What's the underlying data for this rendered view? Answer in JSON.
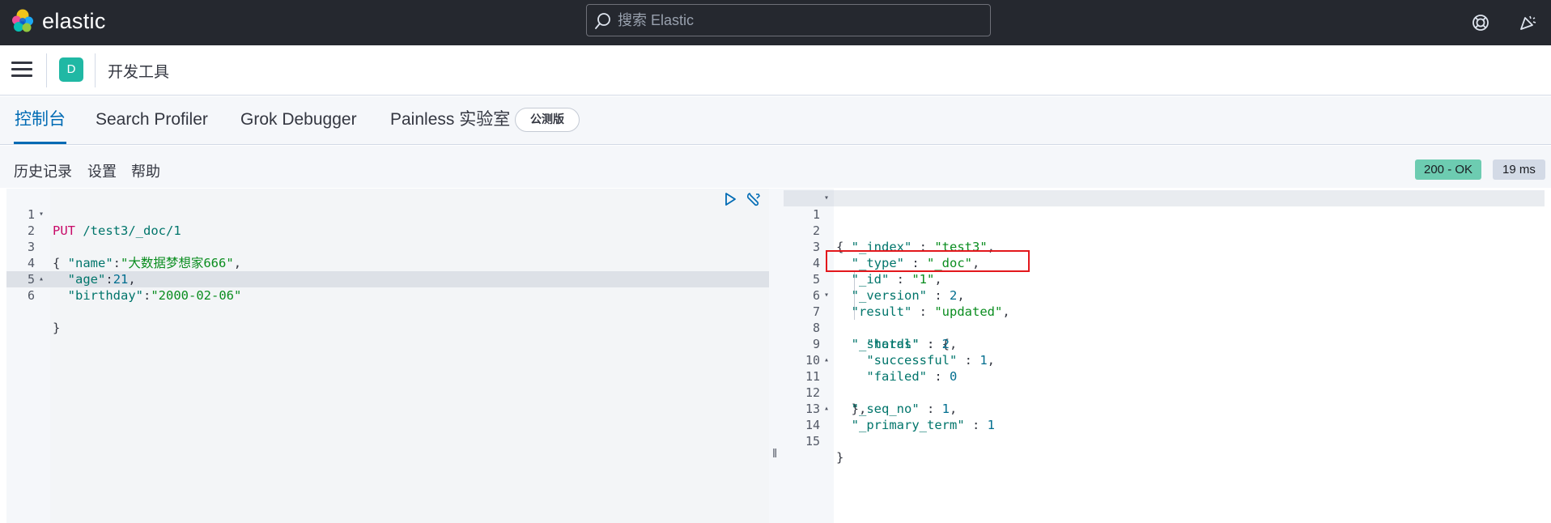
{
  "header": {
    "brand": "elastic",
    "search_placeholder": "搜索 Elastic",
    "help_icon": "lifebuoy-icon",
    "news_icon": "newsfeed-icon"
  },
  "subbar": {
    "space_initial": "D",
    "breadcrumb": "开发工具"
  },
  "tabs": [
    {
      "label": "控制台",
      "active": true
    },
    {
      "label": "Search Profiler",
      "active": false
    },
    {
      "label": "Grok Debugger",
      "active": false
    },
    {
      "label": "Painless 实验室",
      "active": false
    }
  ],
  "beta_badge": "公测版",
  "toolbar": {
    "history": "历史记录",
    "settings": "设置",
    "help": "帮助",
    "status": "200 - OK",
    "time": "19 ms"
  },
  "request": {
    "line_numbers": [
      "1",
      "2",
      "3",
      "4",
      "5",
      "6"
    ],
    "method": "PUT",
    "url": " /test3/_doc/1",
    "open_brace": "{",
    "name_key": "\"name\"",
    "name_val": "\"大数据梦想家666\"",
    "age_key": "\"age\"",
    "age_val": "21",
    "birthday_key": "\"birthday\"",
    "birthday_val": "\"2000-02-06\"",
    "close_brace": "}"
  },
  "response": {
    "line_numbers": [
      "1",
      "2",
      "3",
      "4",
      "5",
      "6",
      "7",
      "8",
      "9",
      "10",
      "11",
      "12",
      "13",
      "14",
      "15"
    ],
    "open_brace": "{",
    "index_key": "\"_index\"",
    "index_val": "\"test3\"",
    "type_key": "\"_type\"",
    "type_val": "\"_doc\"",
    "id_key": "\"_id\"",
    "id_val": "\"1\"",
    "version_key": "\"_version\"",
    "version_val": "2",
    "result_key": "\"result\"",
    "result_val": "\"updated\"",
    "shards_key": "\"_shards\"",
    "total_key": "\"total\"",
    "total_val": "2",
    "successful_key": "\"successful\"",
    "successful_val": "1",
    "failed_key": "\"failed\"",
    "failed_val": "0",
    "shards_close": "},",
    "seq_key": "\"_seq_no\"",
    "seq_val": "1",
    "term_key": "\"_primary_term\"",
    "term_val": "1",
    "close_brace": "}"
  },
  "colors": {
    "header_bg": "#25282f",
    "accent": "#006bb4",
    "status_ok": "#6dccb1",
    "annotation": "#e3171c"
  }
}
